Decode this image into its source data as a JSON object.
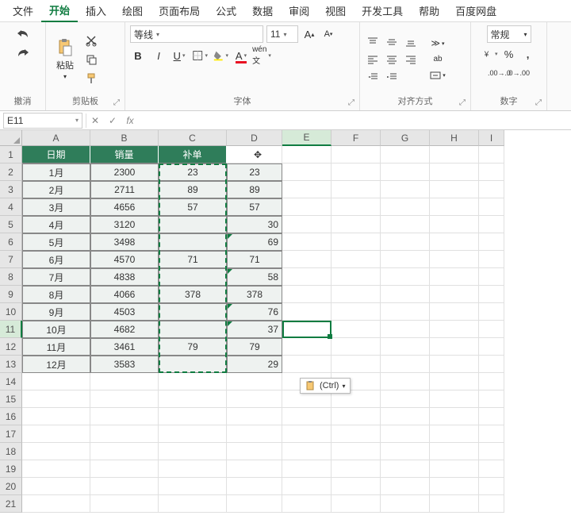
{
  "tabs": [
    "文件",
    "开始",
    "插入",
    "绘图",
    "页面布局",
    "公式",
    "数据",
    "审阅",
    "视图",
    "开发工具",
    "帮助",
    "百度网盘"
  ],
  "active_tab": 1,
  "ribbon": {
    "undo_label": "撤消",
    "clipboard_label": "剪贴板",
    "paste_label": "粘贴",
    "font_label": "字体",
    "font_name": "等线",
    "font_size": "11",
    "align_label": "对齐方式",
    "number_label": "数字",
    "number_format": "常规"
  },
  "namebox": "E11",
  "formula": "",
  "columns": [
    "A",
    "B",
    "C",
    "D",
    "E",
    "F",
    "G",
    "H",
    "I"
  ],
  "header_row": [
    "日期",
    "销量",
    "补单"
  ],
  "table": [
    {
      "a": "1月",
      "b": "2300",
      "c": "23",
      "d": "23"
    },
    {
      "a": "2月",
      "b": "2711",
      "c": "89",
      "d": "89"
    },
    {
      "a": "3月",
      "b": "4656",
      "c": "57",
      "d": "57"
    },
    {
      "a": "4月",
      "b": "3120",
      "c": "",
      "d": "30"
    },
    {
      "a": "5月",
      "b": "3498",
      "c": "",
      "d": "69"
    },
    {
      "a": "6月",
      "b": "4570",
      "c": "71",
      "d": "71"
    },
    {
      "a": "7月",
      "b": "4838",
      "c": "",
      "d": "58"
    },
    {
      "a": "8月",
      "b": "4066",
      "c": "378",
      "d": "378"
    },
    {
      "a": "9月",
      "b": "4503",
      "c": "",
      "d": "76"
    },
    {
      "a": "10月",
      "b": "4682",
      "c": "",
      "d": "37"
    },
    {
      "a": "11月",
      "b": "3461",
      "c": "79",
      "d": "79"
    },
    {
      "a": "12月",
      "b": "3583",
      "c": "",
      "d": "29"
    }
  ],
  "paste_options_label": "(Ctrl)",
  "active_cell": "E11",
  "selected_col": "E",
  "selected_row": "11"
}
